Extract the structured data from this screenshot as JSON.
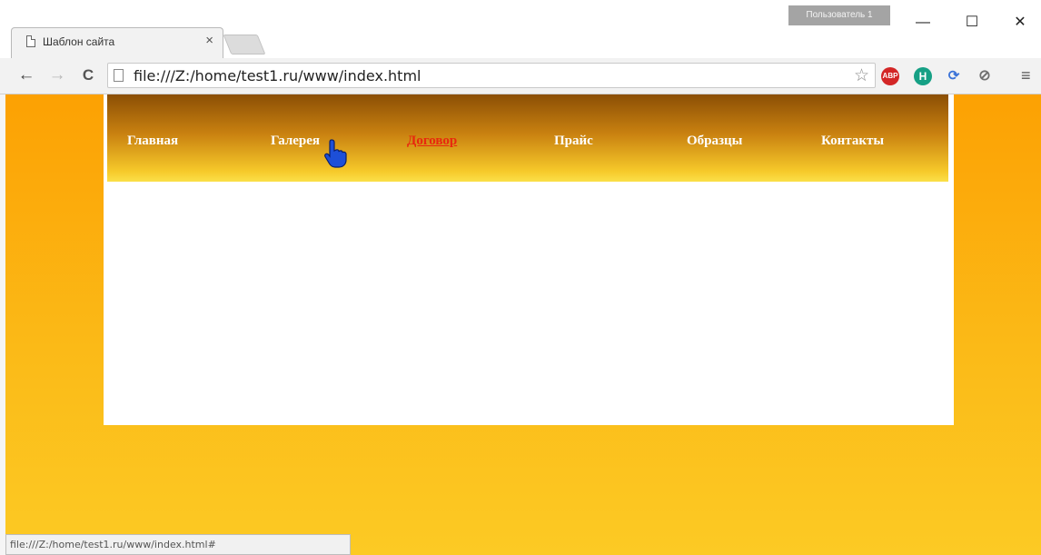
{
  "browser": {
    "tab_title": "Шаблон сайта",
    "tab_close": "×",
    "profile_label": "Пользователь 1",
    "minimize": "—",
    "maximize": "☐",
    "close": "✕",
    "url": "file:///Z:/home/test1.ru/www/index.html",
    "status_url": "file:///Z:/home/test1.ru/www/index.html#"
  },
  "nav_icons": {
    "back": "←",
    "forward": "→",
    "reload": "C",
    "star": "☆",
    "menu": "≡"
  },
  "extensions": [
    {
      "name": "adblock-icon",
      "label": "ABP",
      "color": "#d32626"
    },
    {
      "name": "h-extension-icon",
      "label": "H",
      "color": "#16a085"
    },
    {
      "name": "sync-icon",
      "label": "⟳",
      "color": "#3b73d8"
    },
    {
      "name": "block-icon",
      "label": "⊘",
      "color": "#707070"
    }
  ],
  "site_menu": [
    {
      "label": "Главная",
      "active": false
    },
    {
      "label": "Галерея",
      "active": false
    },
    {
      "label": "Договор",
      "active": true
    },
    {
      "label": "Прайс",
      "active": false
    },
    {
      "label": "Образцы",
      "active": false
    },
    {
      "label": "Контакты",
      "active": false
    }
  ],
  "colors": {
    "menu_text": "#ffffff",
    "menu_active": "#e8280e",
    "page_background": "#fca103",
    "menu_bar_top": "#8b4f05",
    "menu_bar_bottom": "#fbe049"
  }
}
